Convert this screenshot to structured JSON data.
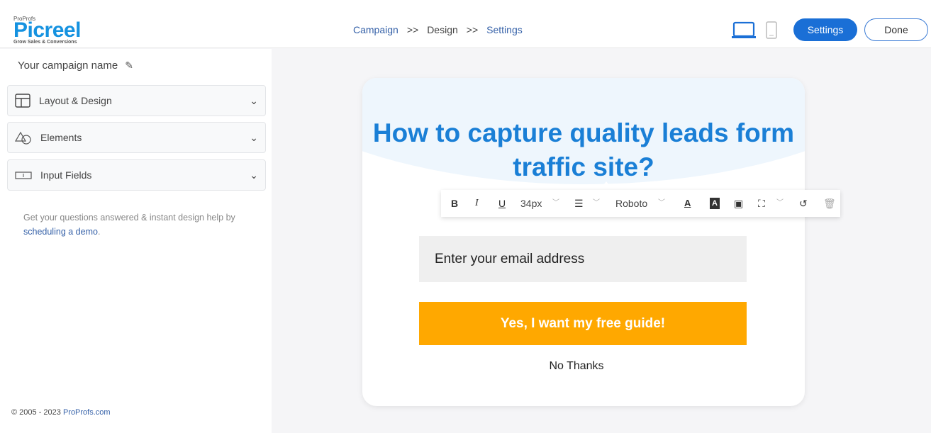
{
  "brand": {
    "small": "ProProfs",
    "name": "Picreel",
    "tagline": "Grow Sales & Conversions"
  },
  "breadcrumb": [
    {
      "label": "Campaign"
    },
    {
      "label": ">>"
    },
    {
      "label": "Design"
    },
    {
      "label": ">>"
    },
    {
      "label": "Settings"
    }
  ],
  "header": {
    "settings_label": "Settings",
    "done_label": "Done",
    "accent": "#1a6fd6"
  },
  "sidebar": {
    "campaign_name": "Your campaign name",
    "sections": [
      {
        "label": "Layout & Design",
        "icon": "layout-icon"
      },
      {
        "label": "Elements",
        "icon": "shapes-icon"
      },
      {
        "label": "Input Fields",
        "icon": "input-field-icon"
      }
    ],
    "help_text": "Get your questions answered & instant design help by ",
    "help_link": "scheduling a demo",
    "help_end": ".",
    "copyright": "© 2005 - 2023 ",
    "copyright_link": "ProProfs.com"
  },
  "toolbar": {
    "font_size": "34px",
    "font": "Roboto",
    "bold": "B",
    "italic": "I",
    "underline": "U"
  },
  "popup": {
    "headline": "How to capture quality leads form traffic site?",
    "email_placeholder": "Enter your email address",
    "cta": "Yes, I want my free guide!",
    "decline": "No Thanks",
    "headline_color": "#1a7fd6",
    "cta_color": "#ffa800"
  }
}
